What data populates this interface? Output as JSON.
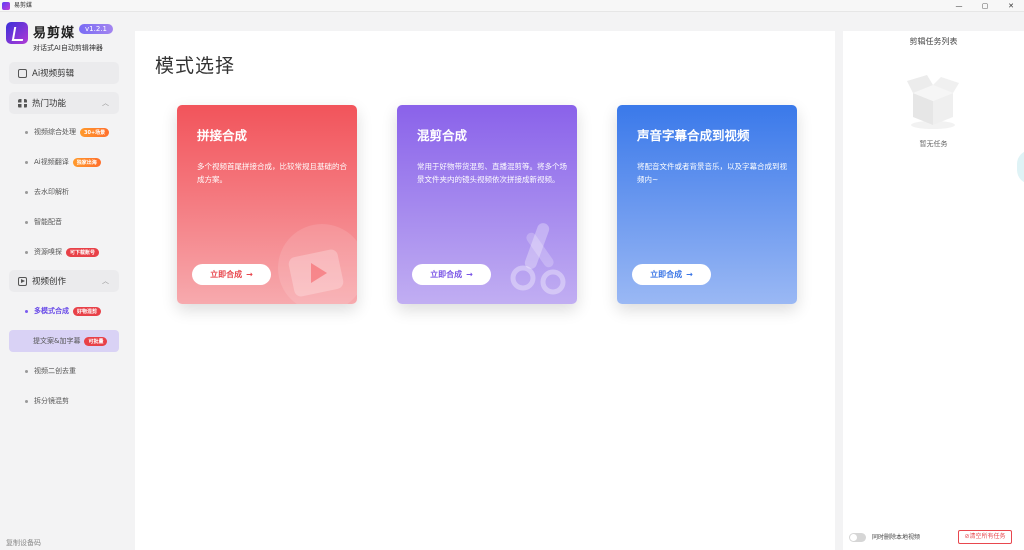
{
  "window": {
    "title": "易剪媒",
    "minimize": "—",
    "maximize": "▢",
    "close": "✕"
  },
  "brand": {
    "name": "易剪媒",
    "version": "v1.2.1",
    "subtitle": "对话式AI自动剪辑神器"
  },
  "sidebar": {
    "ai_edit": "Ai视频剪辑",
    "hot": {
      "label": "热门功能",
      "items": [
        {
          "label": "视频综合处理",
          "badge": "30+场景"
        },
        {
          "label": "Ai视频翻译",
          "badge": "独家出海"
        },
        {
          "label": "去水印解析"
        },
        {
          "label": "智能配音"
        },
        {
          "label": "资源嗅探",
          "badge": "可下载账号"
        }
      ]
    },
    "create": {
      "label": "视频创作",
      "items": [
        {
          "label": "多模式合成",
          "badge": "好物混剪"
        },
        {
          "label": "提文案&加字幕",
          "badge": "可批量"
        },
        {
          "label": "视频二创去重"
        },
        {
          "label": "拆分镜混剪"
        }
      ]
    },
    "copy_code": "复制设备码"
  },
  "main": {
    "title": "模式选择",
    "cards": [
      {
        "title": "拼接合成",
        "desc": "多个视频首尾拼接合成，比较常规且基础的合成方案。",
        "button": "立即合成",
        "arrow": "→"
      },
      {
        "title": "混剪合成",
        "desc": "常用于好物带货混剪、直播混剪等。将多个场景文件夹内的镜头视频依次拼接成新视频。",
        "button": "立即合成",
        "arrow": "→"
      },
      {
        "title": "声音字幕合成到视频",
        "desc": "将配音文件或者背景音乐，以及字幕合成到视频内~",
        "button": "立即合成",
        "arrow": "→"
      }
    ]
  },
  "task_panel": {
    "title": "剪辑任务列表",
    "empty": "暂无任务",
    "toggle_label": "同时删除本地视频",
    "toggle_on": false,
    "clear_button": "清空所有任务"
  },
  "colors": {
    "accent": "#7b5cf0",
    "card1": "#f2545b",
    "card2": "#8a62ea",
    "card3": "#3a79ea",
    "danger": "#e8474e"
  }
}
